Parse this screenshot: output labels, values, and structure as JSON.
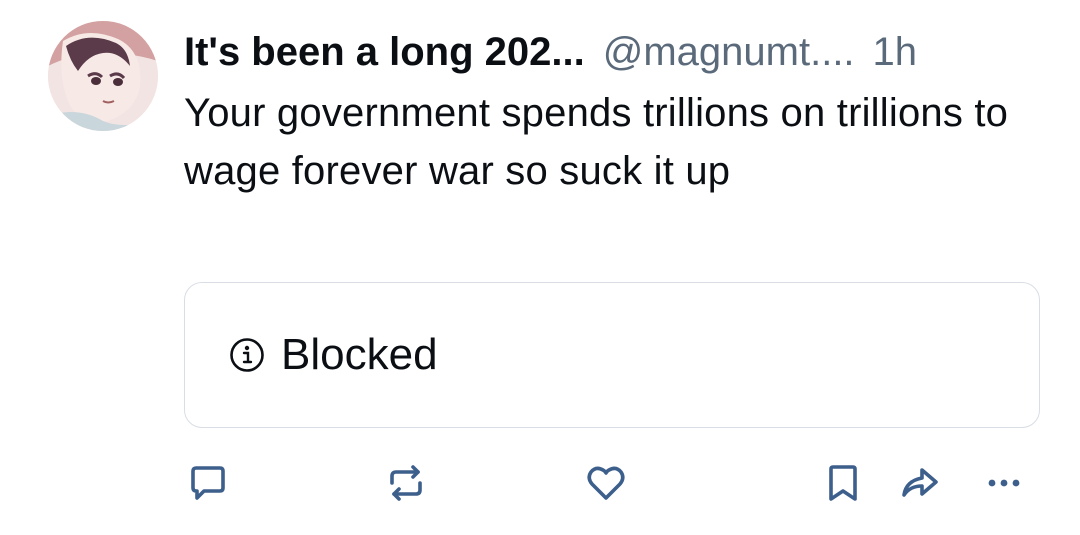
{
  "post": {
    "display_name": "It's been a long 202...",
    "handle": "@magnumt....",
    "time": "1h",
    "text": "Your government spends trillions on trillions to wage forever war so suck it up",
    "embed": {
      "icon": "info-icon",
      "label": "Blocked"
    }
  },
  "actions": {
    "reply_icon": "reply-icon",
    "repost_icon": "repost-icon",
    "like_icon": "heart-icon",
    "bookmark_icon": "bookmark-icon",
    "share_icon": "share-icon",
    "more_icon": "more-icon"
  },
  "colors": {
    "text": "#0b0f14",
    "muted": "#5a6a7a",
    "icon": "#3d5f8c",
    "border": "#d9dee4"
  }
}
